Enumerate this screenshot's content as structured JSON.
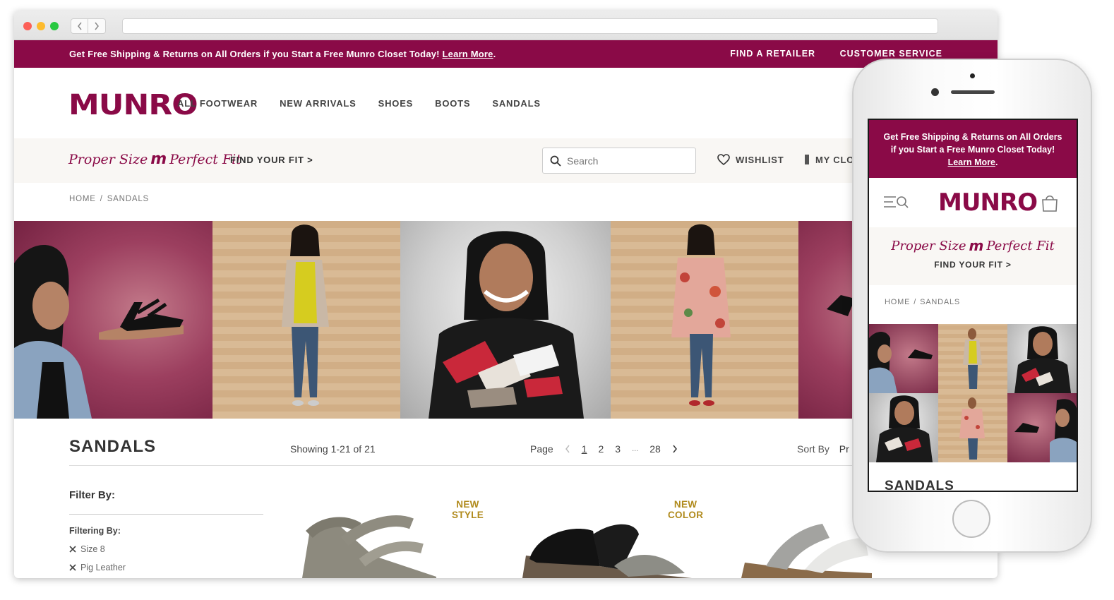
{
  "promo": {
    "text": "Get Free Shipping & Returns on All Orders if you Start a Free Munro Closet Today!",
    "link": "Learn More",
    "period": ".",
    "find_retailer": "FIND A RETAILER",
    "customer_service": "CUSTOMER SERVICE"
  },
  "brand": {
    "logo": "MUNRO",
    "color": "#8a0a47",
    "accent": "#b08a1c"
  },
  "nav": [
    "ALL FOOTWEAR",
    "NEW ARRIVALS",
    "SHOES",
    "BOOTS",
    "SANDALS"
  ],
  "fit": {
    "proper": "Proper Size",
    "perfect": "Perfect Fit",
    "mark": "m",
    "link": "FIND YOUR FIT >"
  },
  "search": {
    "placeholder": "Search",
    "icon": "search-icon"
  },
  "wishlist": {
    "label": "WISHLIST",
    "icon": "heart-icon"
  },
  "closet": {
    "label": "MY CLO",
    "icon": "closet-icon"
  },
  "breadcrumb": {
    "home": "HOME",
    "sep": "/",
    "current": "SANDALS"
  },
  "listing": {
    "title": "SANDALS",
    "showing": "Showing 1-21 of 21",
    "page_label": "Page",
    "pages": [
      "1",
      "2",
      "3",
      "...",
      "28"
    ],
    "sort": "Sort By",
    "sort_value": "Pr"
  },
  "filter": {
    "title": "Filter By:",
    "filtering": "Filtering By:",
    "chips": [
      "Size 8",
      "Pig Leather"
    ]
  },
  "badges": {
    "new_style": [
      "NEW",
      "STYLE"
    ],
    "new_color": [
      "NEW",
      "COLOR"
    ]
  },
  "mobile": {
    "promo": "Get Free Shipping & Returns on All Orders if you Start a Free Munro Closet Today!",
    "promo_link": "Learn More",
    "logo": "MUNRO",
    "fit_proper": "Proper Size",
    "fit_perfect": "Perfect Fit",
    "fit_link": "FIND YOUR FIT >",
    "crumb_home": "HOME",
    "crumb_current": "SANDALS",
    "title": "SANDALS"
  }
}
